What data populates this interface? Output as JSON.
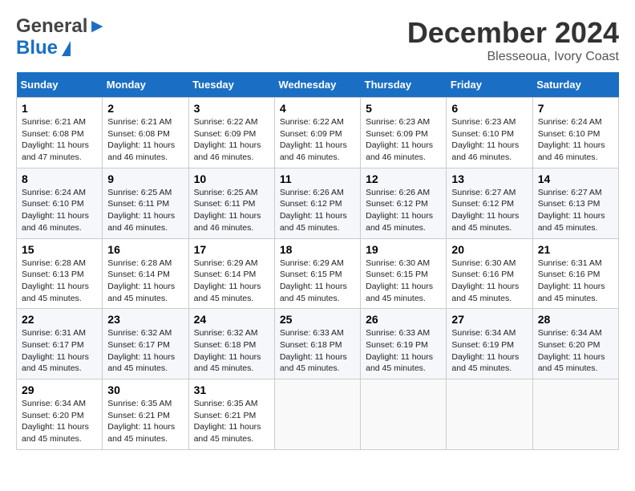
{
  "header": {
    "logo_line1": "General",
    "logo_line2": "Blue",
    "month": "December 2024",
    "location": "Blesseoua, Ivory Coast"
  },
  "days_of_week": [
    "Sunday",
    "Monday",
    "Tuesday",
    "Wednesday",
    "Thursday",
    "Friday",
    "Saturday"
  ],
  "weeks": [
    [
      {
        "day": "1",
        "sunrise": "6:21 AM",
        "sunset": "6:08 PM",
        "daylight": "11 hours and 47 minutes."
      },
      {
        "day": "2",
        "sunrise": "6:21 AM",
        "sunset": "6:08 PM",
        "daylight": "11 hours and 46 minutes."
      },
      {
        "day": "3",
        "sunrise": "6:22 AM",
        "sunset": "6:09 PM",
        "daylight": "11 hours and 46 minutes."
      },
      {
        "day": "4",
        "sunrise": "6:22 AM",
        "sunset": "6:09 PM",
        "daylight": "11 hours and 46 minutes."
      },
      {
        "day": "5",
        "sunrise": "6:23 AM",
        "sunset": "6:09 PM",
        "daylight": "11 hours and 46 minutes."
      },
      {
        "day": "6",
        "sunrise": "6:23 AM",
        "sunset": "6:10 PM",
        "daylight": "11 hours and 46 minutes."
      },
      {
        "day": "7",
        "sunrise": "6:24 AM",
        "sunset": "6:10 PM",
        "daylight": "11 hours and 46 minutes."
      }
    ],
    [
      {
        "day": "8",
        "sunrise": "6:24 AM",
        "sunset": "6:10 PM",
        "daylight": "11 hours and 46 minutes."
      },
      {
        "day": "9",
        "sunrise": "6:25 AM",
        "sunset": "6:11 PM",
        "daylight": "11 hours and 46 minutes."
      },
      {
        "day": "10",
        "sunrise": "6:25 AM",
        "sunset": "6:11 PM",
        "daylight": "11 hours and 46 minutes."
      },
      {
        "day": "11",
        "sunrise": "6:26 AM",
        "sunset": "6:12 PM",
        "daylight": "11 hours and 45 minutes."
      },
      {
        "day": "12",
        "sunrise": "6:26 AM",
        "sunset": "6:12 PM",
        "daylight": "11 hours and 45 minutes."
      },
      {
        "day": "13",
        "sunrise": "6:27 AM",
        "sunset": "6:12 PM",
        "daylight": "11 hours and 45 minutes."
      },
      {
        "day": "14",
        "sunrise": "6:27 AM",
        "sunset": "6:13 PM",
        "daylight": "11 hours and 45 minutes."
      }
    ],
    [
      {
        "day": "15",
        "sunrise": "6:28 AM",
        "sunset": "6:13 PM",
        "daylight": "11 hours and 45 minutes."
      },
      {
        "day": "16",
        "sunrise": "6:28 AM",
        "sunset": "6:14 PM",
        "daylight": "11 hours and 45 minutes."
      },
      {
        "day": "17",
        "sunrise": "6:29 AM",
        "sunset": "6:14 PM",
        "daylight": "11 hours and 45 minutes."
      },
      {
        "day": "18",
        "sunrise": "6:29 AM",
        "sunset": "6:15 PM",
        "daylight": "11 hours and 45 minutes."
      },
      {
        "day": "19",
        "sunrise": "6:30 AM",
        "sunset": "6:15 PM",
        "daylight": "11 hours and 45 minutes."
      },
      {
        "day": "20",
        "sunrise": "6:30 AM",
        "sunset": "6:16 PM",
        "daylight": "11 hours and 45 minutes."
      },
      {
        "day": "21",
        "sunrise": "6:31 AM",
        "sunset": "6:16 PM",
        "daylight": "11 hours and 45 minutes."
      }
    ],
    [
      {
        "day": "22",
        "sunrise": "6:31 AM",
        "sunset": "6:17 PM",
        "daylight": "11 hours and 45 minutes."
      },
      {
        "day": "23",
        "sunrise": "6:32 AM",
        "sunset": "6:17 PM",
        "daylight": "11 hours and 45 minutes."
      },
      {
        "day": "24",
        "sunrise": "6:32 AM",
        "sunset": "6:18 PM",
        "daylight": "11 hours and 45 minutes."
      },
      {
        "day": "25",
        "sunrise": "6:33 AM",
        "sunset": "6:18 PM",
        "daylight": "11 hours and 45 minutes."
      },
      {
        "day": "26",
        "sunrise": "6:33 AM",
        "sunset": "6:19 PM",
        "daylight": "11 hours and 45 minutes."
      },
      {
        "day": "27",
        "sunrise": "6:34 AM",
        "sunset": "6:19 PM",
        "daylight": "11 hours and 45 minutes."
      },
      {
        "day": "28",
        "sunrise": "6:34 AM",
        "sunset": "6:20 PM",
        "daylight": "11 hours and 45 minutes."
      }
    ],
    [
      {
        "day": "29",
        "sunrise": "6:34 AM",
        "sunset": "6:20 PM",
        "daylight": "11 hours and 45 minutes."
      },
      {
        "day": "30",
        "sunrise": "6:35 AM",
        "sunset": "6:21 PM",
        "daylight": "11 hours and 45 minutes."
      },
      {
        "day": "31",
        "sunrise": "6:35 AM",
        "sunset": "6:21 PM",
        "daylight": "11 hours and 45 minutes."
      },
      null,
      null,
      null,
      null
    ]
  ]
}
